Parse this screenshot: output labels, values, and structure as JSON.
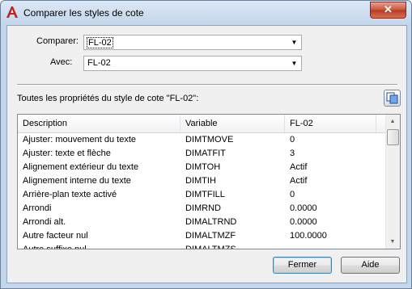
{
  "window": {
    "title": "Comparer les styles de cote",
    "close_glyph": "✕"
  },
  "compare": {
    "label": "Comparer:",
    "value": "FL-02"
  },
  "with": {
    "label": "Avec:",
    "value": "FL-02"
  },
  "section_label": "Toutes les propriétés du style de cote \"FL-02\":",
  "table": {
    "columns": [
      "Description",
      "Variable",
      "FL-02"
    ],
    "rows": [
      [
        "Ajuster: mouvement du texte",
        "DIMTMOVE",
        "0"
      ],
      [
        "Ajuster: texte et flèche",
        "DIMATFIT",
        "3"
      ],
      [
        "Alignement extérieur du texte",
        "DIMTOH",
        "Actif"
      ],
      [
        "Alignement interne du texte",
        "DIMTIH",
        "Actif"
      ],
      [
        "Arrière-plan texte activé",
        "DIMTFILL",
        "0"
      ],
      [
        "Arrondi",
        "DIMRND",
        "0.0000"
      ],
      [
        "Arrondi alt.",
        "DIMALTRND",
        "0.0000"
      ],
      [
        "Autre facteur nul",
        "DIMALTMZF",
        "100.0000"
      ],
      [
        "Autre suffixe nul",
        "DIMALTMZS",
        ""
      ]
    ]
  },
  "buttons": {
    "ok": "Fermer",
    "help": "Aide"
  },
  "icons": {
    "app": "autocad-a-icon",
    "copy": "copy-to-clipboard-icon",
    "dropdown": "chevron-down-icon"
  },
  "colors": {
    "accent": "#c21f1f",
    "title_bg": "#c4d6ec"
  }
}
